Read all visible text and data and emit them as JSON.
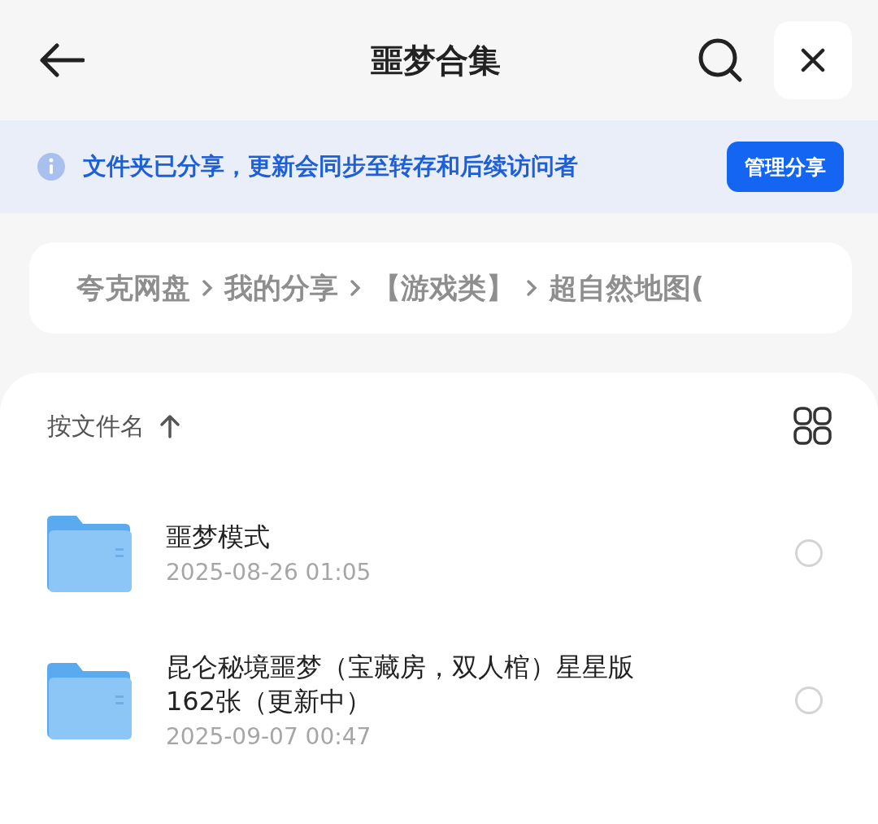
{
  "header": {
    "title": "噩梦合集"
  },
  "share_banner": {
    "message": "文件夹已分享，更新会同步至转存和后续访问者",
    "button": "管理分享"
  },
  "breadcrumbs": [
    "夸克网盘",
    "我的分享",
    "【游戏类】",
    "超自然地图("
  ],
  "sort": {
    "label": "按文件名"
  },
  "files": [
    {
      "name": "噩梦模式",
      "date": "2025-08-26 01:05",
      "selected": false
    },
    {
      "name": "昆仑秘境噩梦（宝藏房，双人棺）星星版162张（更新中）",
      "date": "2025-09-07 00:47",
      "selected": false
    }
  ]
}
